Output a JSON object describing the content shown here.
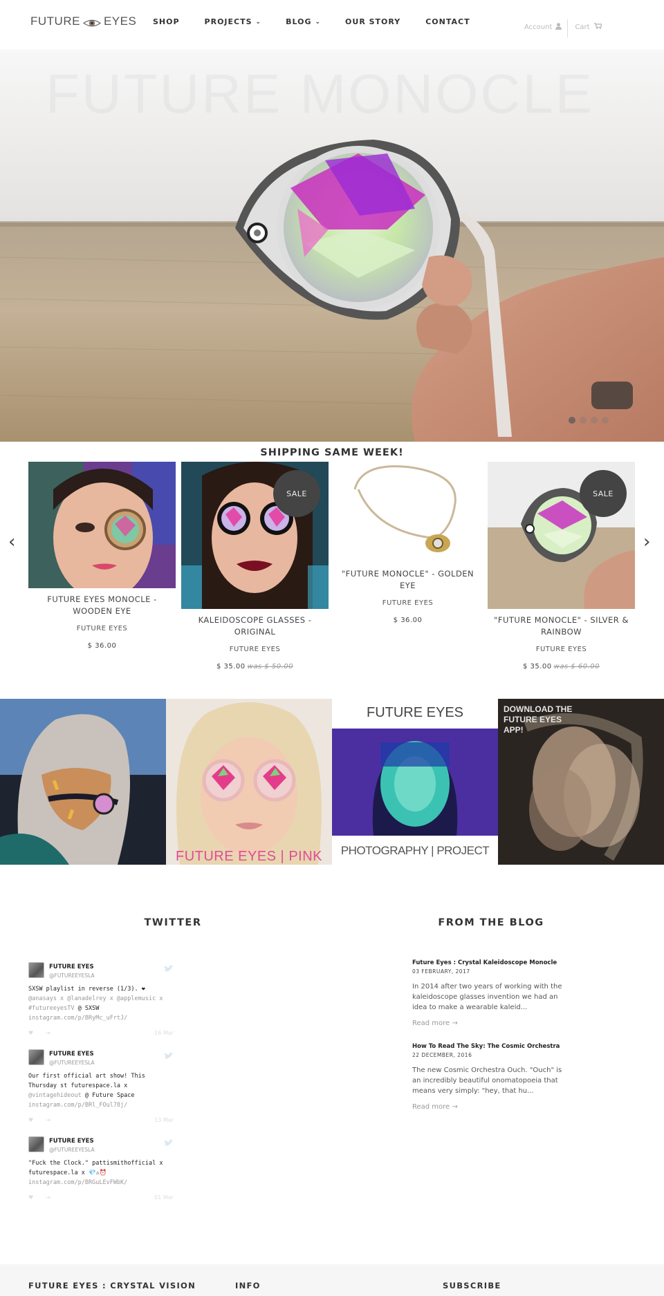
{
  "header": {
    "logo_left": "FUTURE",
    "logo_right": "EYES",
    "nav": [
      {
        "label": "SHOP",
        "dropdown": false
      },
      {
        "label": "PROJECTS",
        "dropdown": true
      },
      {
        "label": "BLOG",
        "dropdown": true
      },
      {
        "label": "OUR STORY",
        "dropdown": false
      },
      {
        "label": "CONTACT",
        "dropdown": false
      }
    ],
    "account_label": "Account",
    "cart_label": "Cart"
  },
  "hero": {
    "title": "FUTURE MONOCLE",
    "slides": 4,
    "active_slide": 1
  },
  "featured": {
    "heading": "SHIPPING SAME WEEK!",
    "products": [
      {
        "name": "FUTURE EYES MONOCLE - WOODEN EYE",
        "vendor": "FUTURE EYES",
        "price": "$ 36.00",
        "was": "",
        "sale": false
      },
      {
        "name": "KALEIDOSCOPE GLASSES - ORIGINAL",
        "vendor": "FUTURE EYES",
        "price": "$ 35.00",
        "was": "was $ 50.00",
        "sale": true,
        "sale_label": "SALE"
      },
      {
        "name": "\"FUTURE MONOCLE\" - GOLDEN EYE",
        "vendor": "FUTURE EYES",
        "price": "$ 36.00",
        "was": "",
        "sale": false
      },
      {
        "name": "\"FUTURE MONOCLE\" - SILVER & RAINBOW",
        "vendor": "FUTURE EYES",
        "price": "$ 35.00",
        "was": "was $ 60.00",
        "sale": true,
        "sale_label": "SALE"
      }
    ]
  },
  "tiles": [
    {
      "caption": ""
    },
    {
      "caption": "FUTURE EYES | PINK"
    },
    {
      "top_caption": "FUTURE EYES",
      "caption": "PHOTOGRAPHY | PROJECT"
    },
    {
      "caption": "DOWNLOAD THE FUTURE EYES APP!"
    }
  ],
  "twitter": {
    "heading": "TWITTER",
    "tweets": [
      {
        "name": "FUTURE EYES",
        "handle": "@FUTUREEYESLA",
        "text": "SXSW playlist in reverse (1/3). ❤",
        "mentions": "@anasays x @lanadelrey x @applemusic x #futureeyesTV",
        "tail": " @ SXSW",
        "link": "instagram.com/p/BRyMc_uFrtJ/",
        "date": "16 Mar"
      },
      {
        "name": "FUTURE EYES",
        "handle": "@FUTUREEYESLA",
        "text": "Our first official art show! This Thursday st futurespace.la x",
        "mentions": "@vintagehideout",
        "tail": " @ Future Space",
        "link": "instagram.com/p/BRl_FOul78j/",
        "date": "13 Mar"
      },
      {
        "name": "FUTURE EYES",
        "handle": "@FUTUREEYESLA",
        "text": "\"Fuck the Clock.\" pattismithofficial x futurespace.la x 💎⚠⏰",
        "mentions": "",
        "tail": "",
        "link": "instagram.com/p/BRGuLEvFWbK/",
        "date": "01 Mar"
      }
    ]
  },
  "blog": {
    "heading": "FROM THE BLOG",
    "posts": [
      {
        "title": "Future Eyes : Crystal Kaleidoscope Monocle",
        "date": "03 FEBRUARY, 2017",
        "excerpt": "In 2014 after two years of working with the kaleidoscope glasses invention we had an idea to make a wearable kaleid...",
        "more": "Read more →"
      },
      {
        "title": "How To Read The Sky: The Cosmic Orchestra",
        "date": "22 DECEMBER, 2016",
        "excerpt": "The new Cosmic Orchestra Ouch. \"Ouch\" is an incredibly beautiful onomatopoeia that means very simply: \"hey, that hu...",
        "more": "Read more →"
      }
    ]
  },
  "footer": {
    "col1": "FUTURE EYES : CRYSTAL VISION",
    "col2": "INFO",
    "col3": "SUBSCRIBE"
  }
}
